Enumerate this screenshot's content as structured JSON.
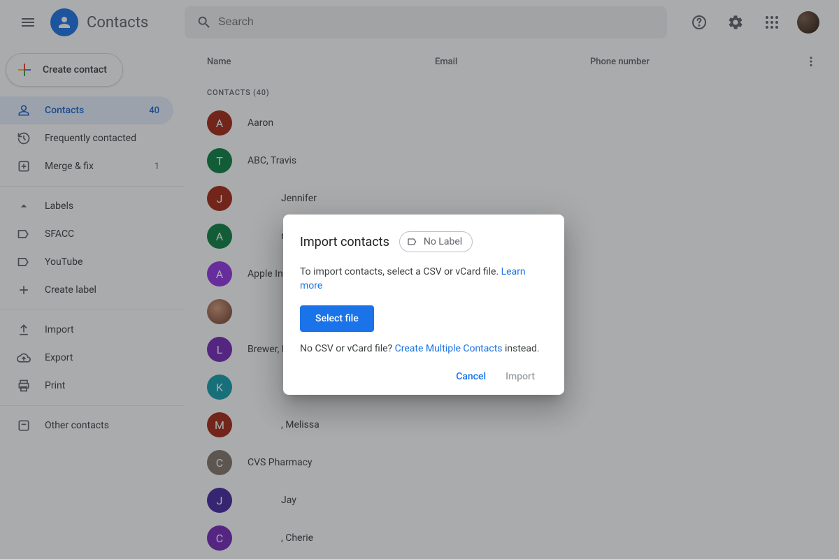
{
  "header": {
    "product": "Contacts",
    "search_placeholder": "Search"
  },
  "create_button": "Create contact",
  "sidebar": {
    "contacts": {
      "label": "Contacts",
      "count": "40"
    },
    "frequent": {
      "label": "Frequently contacted"
    },
    "merge": {
      "label": "Merge & fix",
      "count": "1"
    },
    "labels_header": "Labels",
    "labels": [
      {
        "label": "SFACC"
      },
      {
        "label": "YouTube"
      }
    ],
    "create_label": "Create label",
    "import": "Import",
    "export": "Export",
    "print": "Print",
    "other": "Other contacts"
  },
  "columns": {
    "name": "Name",
    "email": "Email",
    "phone": "Phone number"
  },
  "section_header": "CONTACTS (40)",
  "contacts": [
    {
      "initial": "A",
      "color": "#a52714",
      "name": "Aaron",
      "phone_redacted": true
    },
    {
      "initial": "T",
      "color": "#0b8043",
      "name": "ABC, Travis",
      "phone_redacted": true
    },
    {
      "initial": "J",
      "color": "#a52714",
      "name_prefix_redacted": true,
      "name": "Jennifer",
      "phone_redacted": true
    },
    {
      "initial": "A",
      "color": "#0b8043",
      "name_prefix_redacted": true,
      "name": "ri",
      "phone_redacted": true
    },
    {
      "initial": "A",
      "color": "#9334e6",
      "name": "Apple Inc",
      "phone_redacted": true
    },
    {
      "initial": "",
      "color": "photo",
      "name_prefix_redacted": true,
      "name": "",
      "phone_redacted": false
    },
    {
      "initial": "L",
      "color": "#7627bb",
      "name": "Brewer, L",
      "phone_redacted": false
    },
    {
      "initial": "K",
      "color": "#129eaf",
      "name_prefix_redacted": true,
      "name": "",
      "phone_redacted": true
    },
    {
      "initial": "M",
      "color": "#a52714",
      "name_prefix_redacted": true,
      "name": ", Melissa",
      "phone_redacted": true
    },
    {
      "initial": "C",
      "color": "#82746b",
      "name": "CVS Pharmacy",
      "phone_redacted": true
    },
    {
      "initial": "J",
      "color": "#4527a0",
      "name_prefix_redacted": true,
      "name": "Jay",
      "phone_redacted": true
    },
    {
      "initial": "C",
      "color": "#7627bb",
      "name_prefix_redacted": true,
      "name": ", Cherie",
      "phone_redacted": true
    }
  ],
  "dialog": {
    "title": "Import contacts",
    "chip": "No Label",
    "instruction": "To import contacts, select a CSV or vCard file. ",
    "learn_more": "Learn more",
    "select_file": "Select file",
    "no_file_pre": "No CSV or vCard file? ",
    "create_multiple": "Create Multiple Contacts",
    "no_file_post": " instead.",
    "cancel": "Cancel",
    "import": "Import"
  }
}
